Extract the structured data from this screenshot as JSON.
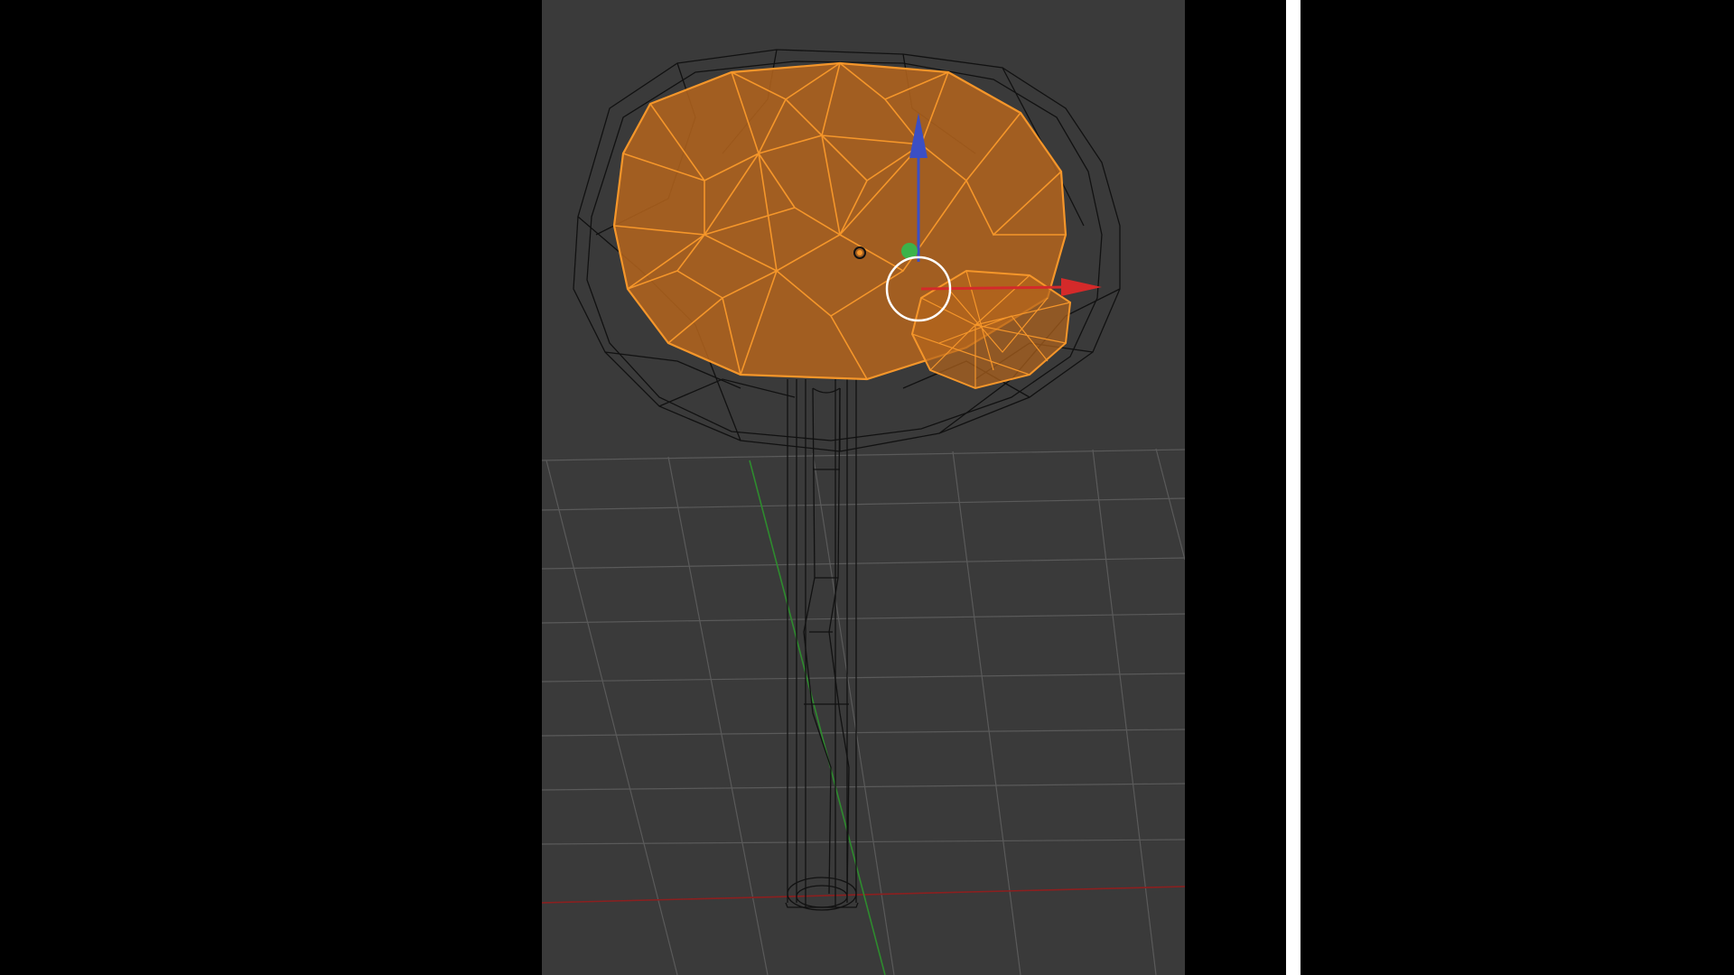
{
  "viewport": {
    "mode": "wireframe",
    "background_color": "#3a3a3a",
    "grid_color": "#5a5a5a",
    "axis_x_color": "#8c1f1f",
    "axis_y_color": "#2e8b2e"
  },
  "scene": {
    "selected_object_color": "#f5962a",
    "selected_fill_color": "#b5651d",
    "unselected_wire_color": "#111111"
  },
  "gizmo": {
    "x_arrow_color": "#d42a2a",
    "y_handle_color": "#3bb34a",
    "z_arrow_color": "#3b4fc4",
    "pivot_ring_color": "#ffffff"
  },
  "panel_divider_color": "#ffffff"
}
